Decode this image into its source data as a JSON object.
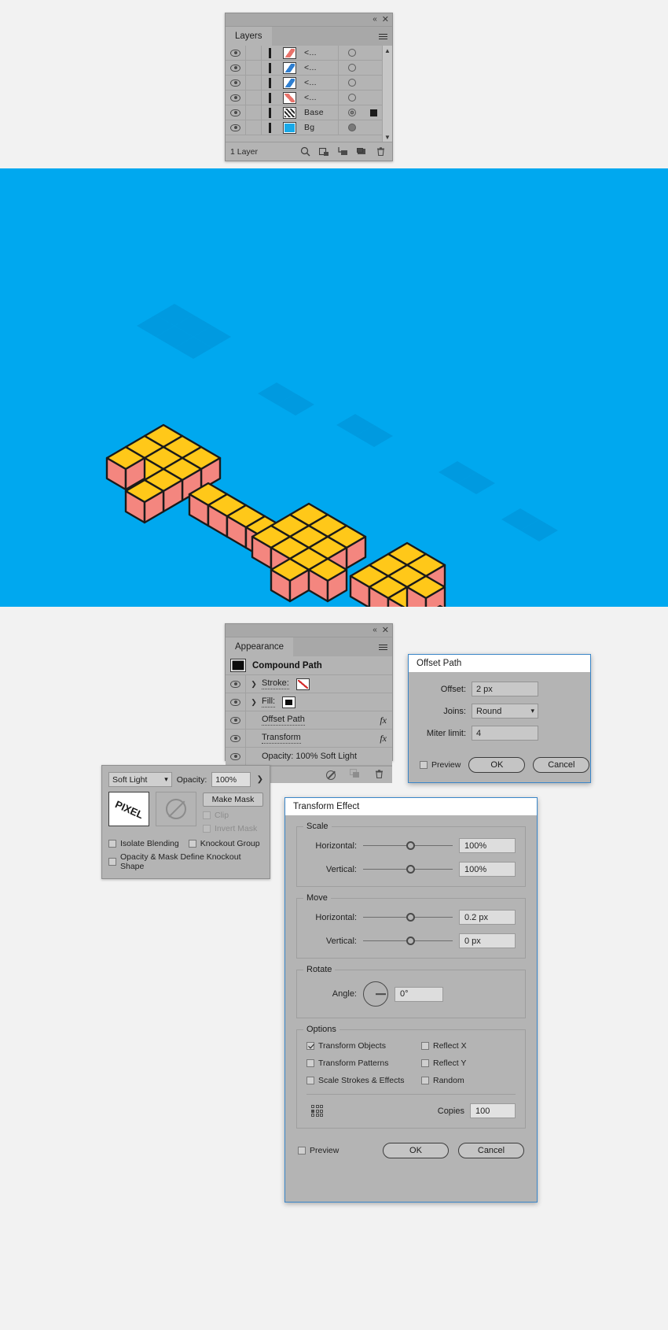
{
  "layers_panel": {
    "tab_label": "Layers",
    "footer_label": "1 Layer",
    "rows": [
      {
        "name": "<...",
        "thumb": "red-parallelogram",
        "target": "ring"
      },
      {
        "name": "<...",
        "thumb": "blue-parallelogram",
        "target": "ring"
      },
      {
        "name": "<...",
        "thumb": "blue-parallelogram",
        "target": "ring"
      },
      {
        "name": "<...",
        "thumb": "red-diagonal",
        "target": "ring"
      },
      {
        "name": "Base",
        "thumb": "dotted-diagonal",
        "target": "double-ring"
      },
      {
        "name": "Bg",
        "thumb": "cyan-fill",
        "target": "filled-ring"
      }
    ],
    "footer_icons": [
      "locate-object-icon",
      "make-sublayer-icon",
      "create-new-sublayer-icon",
      "create-new-layer-icon",
      "delete-selection-icon"
    ]
  },
  "canvas": {
    "background_color": "#00a8ef",
    "artwork_description": "isometric 3D pixel-style lettering",
    "colors": {
      "top_face": "#ffc819",
      "front_face": "#f4867f",
      "outline": "#1a1a1a",
      "shadow": "#0090d4"
    }
  },
  "appearance_panel": {
    "tab_label": "Appearance",
    "header": {
      "label": "Compound Path",
      "swatch": "black"
    },
    "rows": [
      {
        "label": "Stroke:",
        "swatch": "none",
        "has_arrow": true,
        "fx": false
      },
      {
        "label": "Fill:",
        "swatch": "black",
        "has_arrow": true,
        "fx": false
      },
      {
        "label": "Offset Path",
        "has_arrow": false,
        "fx": true
      },
      {
        "label": "Transform",
        "has_arrow": false,
        "fx": true
      },
      {
        "label": "Opacity:  100% Soft Light",
        "has_arrow": false,
        "fx": false
      }
    ],
    "footer_icons": [
      "fx-icon",
      "clear-appearance-icon",
      "duplicate-item-icon",
      "delete-item-icon"
    ]
  },
  "transparency_panel": {
    "blend_mode": "Soft Light",
    "opacity_label": "Opacity:",
    "opacity_value": "100%",
    "thumbnail_text": "PIXEL",
    "make_mask_label": "Make Mask",
    "clip_label": "Clip",
    "clip_checked": false,
    "invert_mask_label": "Invert Mask",
    "invert_mask_checked": false,
    "isolate_blending_label": "Isolate Blending",
    "isolate_blending_checked": false,
    "knockout_group_label": "Knockout Group",
    "knockout_group_checked": false,
    "opacity_mask_label": "Opacity & Mask Define Knockout Shape",
    "opacity_mask_checked": false
  },
  "offset_path_dialog": {
    "title": "Offset Path",
    "offset_label": "Offset:",
    "offset_value": "2 px",
    "joins_label": "Joins:",
    "joins_value": "Round",
    "miter_label": "Miter limit:",
    "miter_value": "4",
    "preview_label": "Preview",
    "preview_checked": false,
    "ok_label": "OK",
    "cancel_label": "Cancel"
  },
  "transform_dialog": {
    "title": "Transform Effect",
    "scale_group": "Scale",
    "scale_horizontal_label": "Horizontal:",
    "scale_horizontal_value": "100%",
    "scale_vertical_label": "Vertical:",
    "scale_vertical_value": "100%",
    "move_group": "Move",
    "move_horizontal_label": "Horizontal:",
    "move_horizontal_value": "0.2 px",
    "move_vertical_label": "Vertical:",
    "move_vertical_value": "0 px",
    "rotate_group": "Rotate",
    "angle_label": "Angle:",
    "angle_value": "0°",
    "options_group": "Options",
    "transform_objects_label": "Transform Objects",
    "transform_objects_checked": true,
    "transform_patterns_label": "Transform Patterns",
    "transform_patterns_checked": false,
    "scale_strokes_label": "Scale Strokes & Effects",
    "scale_strokes_checked": false,
    "reflect_x_label": "Reflect X",
    "reflect_x_checked": false,
    "reflect_y_label": "Reflect Y",
    "reflect_y_checked": false,
    "random_label": "Random",
    "random_checked": false,
    "copies_label": "Copies",
    "copies_value": "100",
    "preview_label": "Preview",
    "preview_checked": false,
    "ok_label": "OK",
    "cancel_label": "Cancel"
  }
}
